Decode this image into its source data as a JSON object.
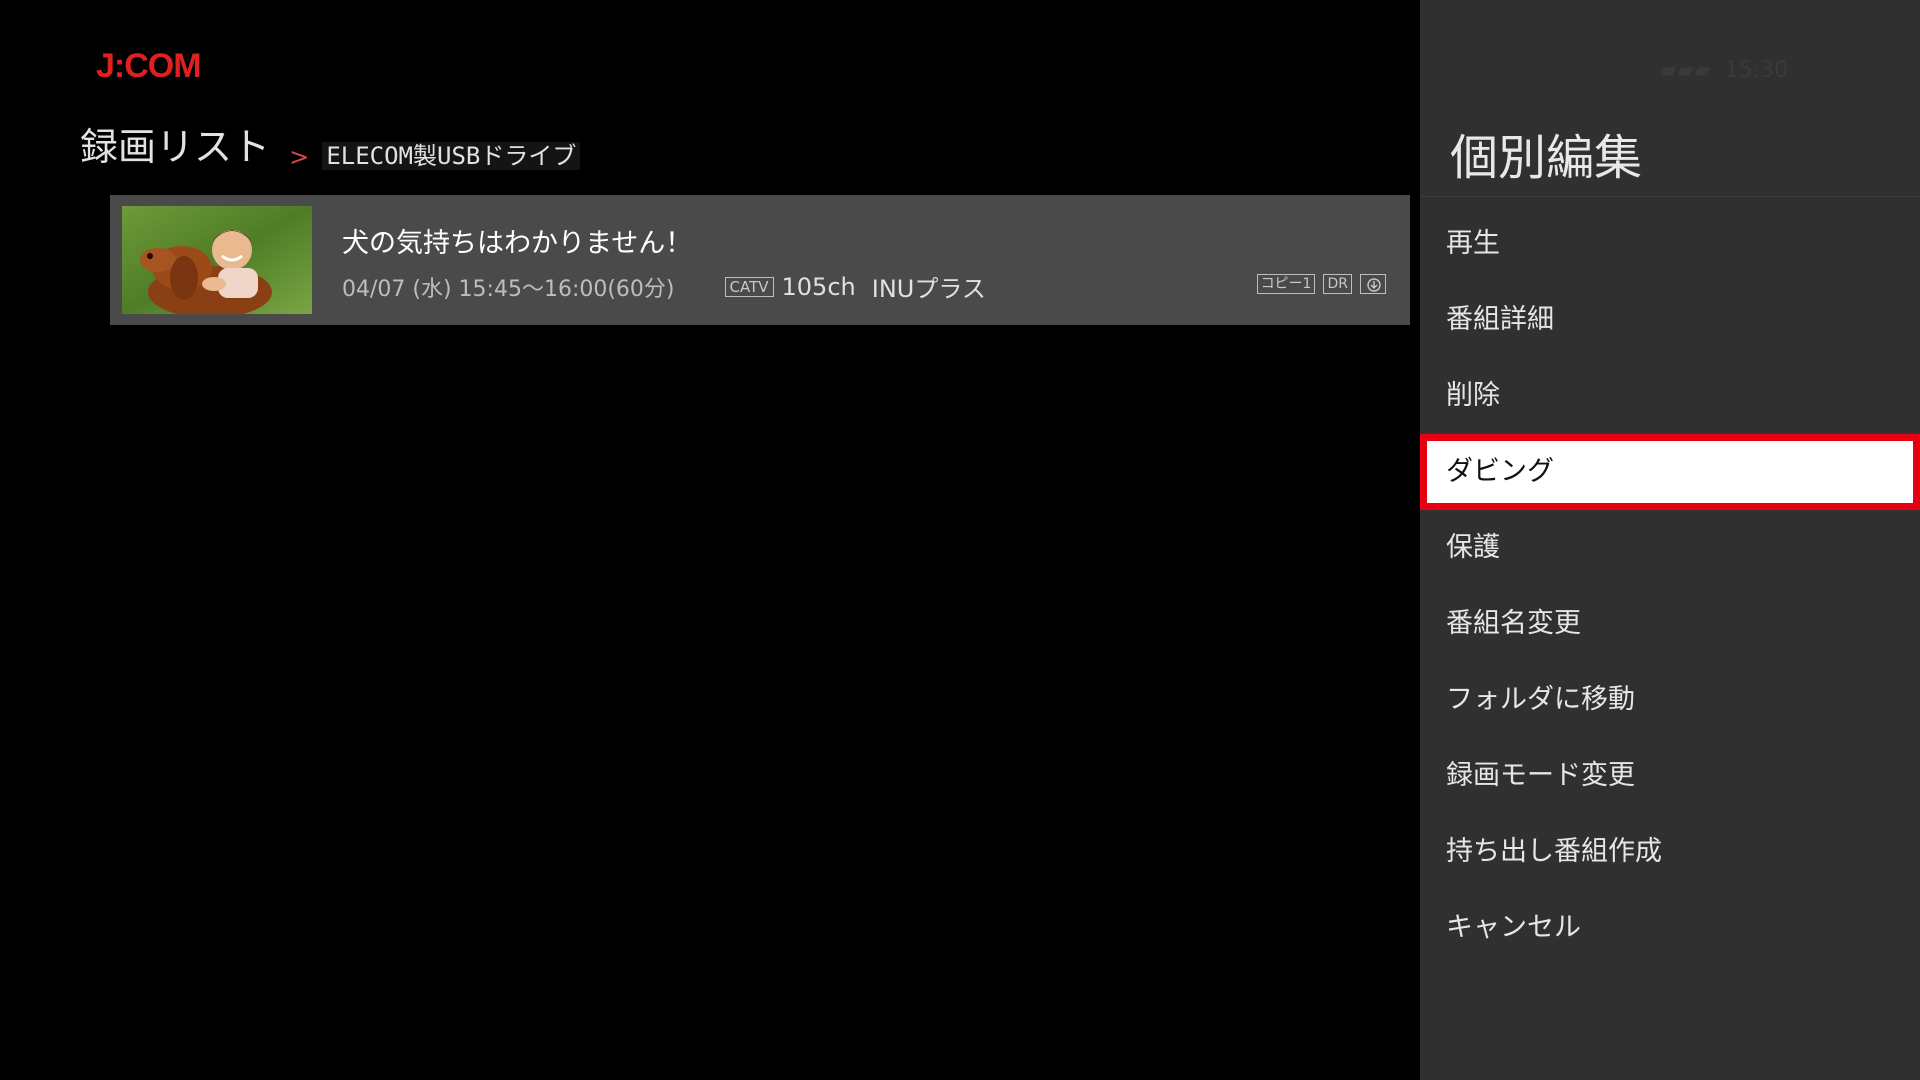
{
  "brand": {
    "logo_text": "J:COM",
    "logo_color": "#e0201e"
  },
  "breadcrumb": {
    "title": "録画リスト",
    "separator": ">",
    "location": "ELECOM製USBドライブ"
  },
  "recording": {
    "title": "犬の気持ちはわかりません！",
    "datetime": "04/07 (水) 15:45〜16:00(60分)",
    "network_tag": "CATV",
    "channel": "105ch",
    "service": "INUプラス",
    "badges": {
      "copy": "コピー1",
      "mode": "DR"
    },
    "thumbnail_icon": "boy-hugging-dog-photo",
    "badge_icon": "portable-download-icon"
  },
  "panel": {
    "title": "個別編集",
    "items": [
      {
        "label": "再生"
      },
      {
        "label": "番組詳細"
      },
      {
        "label": "削除"
      },
      {
        "label": "ダビング",
        "selected": true
      },
      {
        "label": "保護"
      },
      {
        "label": "番組名変更"
      },
      {
        "label": "フォルダに移動"
      },
      {
        "label": "録画モード変更"
      },
      {
        "label": "持ち出し番組作成"
      },
      {
        "label": "キャンセル"
      }
    ],
    "highlight_color": "#e60012"
  }
}
